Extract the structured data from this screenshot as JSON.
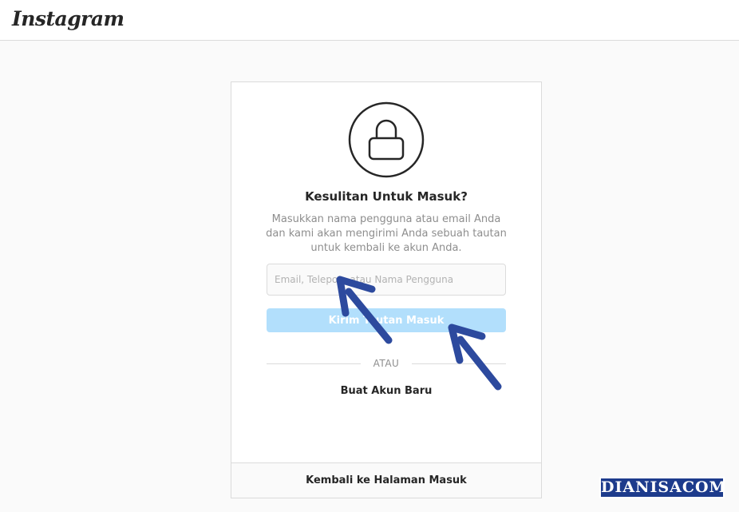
{
  "header": {
    "logo_text": "Instagram"
  },
  "card": {
    "icon": "lock-icon",
    "title": "Kesulitan Untuk Masuk?",
    "description": "Masukkan nama pengguna atau email Anda dan kami akan mengirimi Anda sebuah tautan untuk kembali ke akun Anda.",
    "input": {
      "placeholder": "Email, Telepon, atau Nama Pengguna",
      "value": ""
    },
    "send_button_label": "Kirim Tautan Masuk",
    "divider_text": "ATAU",
    "create_account_link": "Buat Akun Baru",
    "back_to_login_link": "Kembali ke Halaman Masuk"
  },
  "annotations": {
    "arrow_color": "#2d4a9e"
  },
  "watermark": {
    "text": "DIANISACOM"
  },
  "colors": {
    "button_disabled": "#b2dffc",
    "border": "#dbdbdb",
    "background": "#fafafa",
    "muted_text": "#8e8e8e"
  }
}
